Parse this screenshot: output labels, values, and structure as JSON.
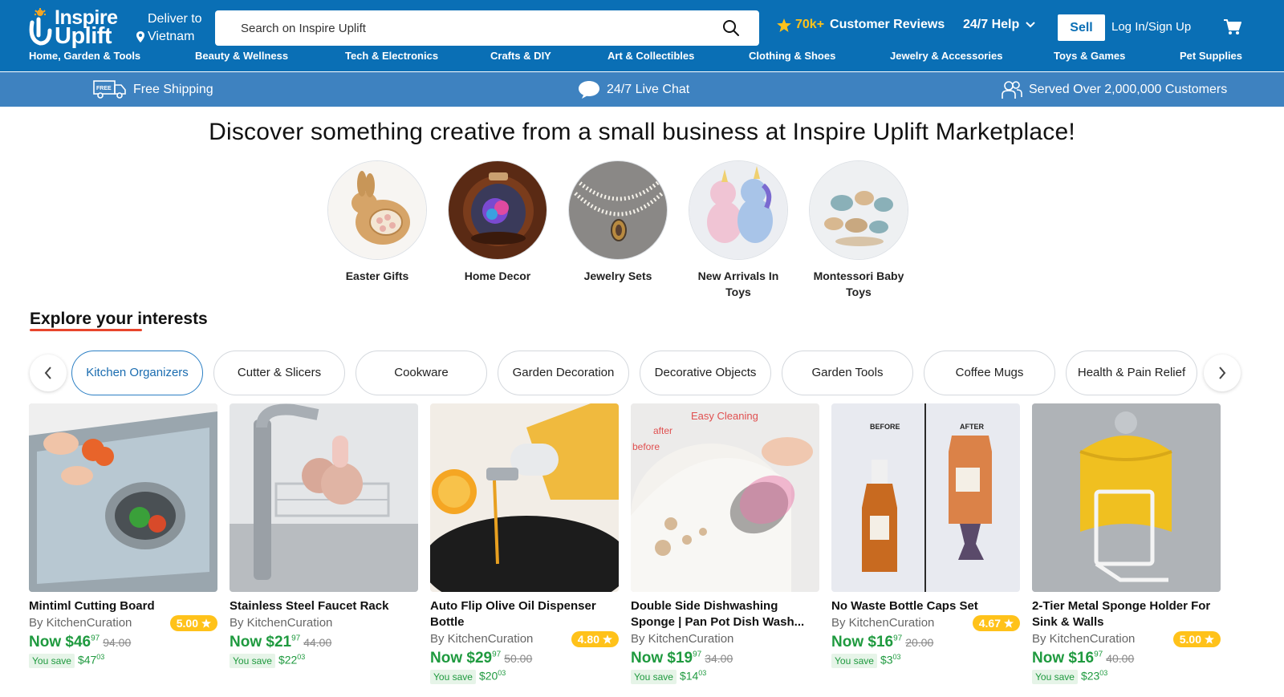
{
  "header": {
    "logo_line1": "Inspire",
    "logo_line2": "Uplift",
    "deliver_label": "Deliver to",
    "deliver_location": "Vietnam",
    "search_placeholder": "Search on Inspire Uplift",
    "reviews_count": "70k+",
    "reviews_label": "Customer Reviews",
    "help_label": "24/7 Help",
    "sell_label": "Sell",
    "login_label": "Log In/Sign Up",
    "brand_color": "#0a6fb5",
    "accent_color": "#ffc21a"
  },
  "nav": [
    "Home, Garden & Tools",
    "Beauty & Wellness",
    "Tech & Electronics",
    "Crafts & DIY",
    "Art & Collectibles",
    "Clothing & Shoes",
    "Jewelry & Accessories",
    "Toys & Games",
    "Pet Supplies"
  ],
  "infobar": {
    "shipping_badge": "FREE",
    "shipping": "Free Shipping",
    "chat": "24/7 Live Chat",
    "customers": "Served Over 2,000,000 Customers"
  },
  "hero": {
    "title": "Discover something creative from a small business at Inspire Uplift Marketplace!",
    "categories": [
      {
        "label": "Easter Gifts",
        "icon": "wooden-bunny-image"
      },
      {
        "label": "Home Decor",
        "icon": "rose-glass-dome-image"
      },
      {
        "label": "Jewelry Sets",
        "icon": "pearl-necklace-image"
      },
      {
        "label": "New Arrivals In Toys",
        "icon": "plush-unicorn-image"
      },
      {
        "label": "Montessori Baby Toys",
        "icon": "wooden-tea-set-image"
      }
    ]
  },
  "explore": {
    "title": "Explore your interests",
    "chips": [
      {
        "label": "Kitchen Organizers",
        "active": true
      },
      {
        "label": "Cutter & Slicers",
        "active": false
      },
      {
        "label": "Cookware",
        "active": false
      },
      {
        "label": "Garden Decoration",
        "active": false
      },
      {
        "label": "Decorative Objects",
        "active": false
      },
      {
        "label": "Garden Tools",
        "active": false
      },
      {
        "label": "Coffee Mugs",
        "active": false
      },
      {
        "label": "Health & Pain Relief",
        "active": false
      }
    ]
  },
  "products": [
    {
      "title": "Mintiml Cutting Board",
      "seller": "By KitchenCuration",
      "rating": "5.00",
      "price_prefix": "Now $",
      "price_int": "46",
      "price_cents": "97",
      "old_price": "94.00",
      "save_label": "You save",
      "save_int": "$47",
      "save_cents": "03",
      "image": "cutting-board-image"
    },
    {
      "title": "Stainless Steel Faucet Rack",
      "seller": "By KitchenCuration",
      "rating": "",
      "price_prefix": "Now $",
      "price_int": "21",
      "price_cents": "97",
      "old_price": "44.00",
      "save_label": "You save",
      "save_int": "$22",
      "save_cents": "03",
      "image": "faucet-rack-image"
    },
    {
      "title": "Auto Flip Olive Oil Dispenser Bottle",
      "seller": "By KitchenCuration",
      "rating": "4.80",
      "price_prefix": "Now $",
      "price_int": "29",
      "price_cents": "97",
      "old_price": "50.00",
      "save_label": "You save",
      "save_int": "$20",
      "save_cents": "03",
      "image": "oil-dispenser-image"
    },
    {
      "title": "Double Side Dishwashing Sponge | Pan Pot Dish Wash...",
      "seller": "By KitchenCuration",
      "rating": "",
      "price_prefix": "Now $",
      "price_int": "19",
      "price_cents": "97",
      "old_price": "34.00",
      "save_label": "You save",
      "save_int": "$14",
      "save_cents": "03",
      "image": "dish-sponge-image",
      "img_text_top": "Easy Cleaning",
      "img_text_after": "after",
      "img_text_before": "before"
    },
    {
      "title": "No Waste Bottle Caps Set",
      "seller": "By KitchenCuration",
      "rating": "4.67",
      "price_prefix": "Now $",
      "price_int": "16",
      "price_cents": "97",
      "old_price": "20.00",
      "save_label": "You save",
      "save_int": "$3",
      "save_cents": "03",
      "image": "bottle-caps-image",
      "img_text_before": "BEFORE",
      "img_text_after": "AFTER"
    },
    {
      "title": "2-Tier Metal Sponge Holder For Sink & Walls",
      "seller": "By KitchenCuration",
      "rating": "5.00",
      "price_prefix": "Now $",
      "price_int": "16",
      "price_cents": "97",
      "old_price": "40.00",
      "save_label": "You save",
      "save_int": "$23",
      "save_cents": "03",
      "image": "sponge-holder-image"
    }
  ]
}
